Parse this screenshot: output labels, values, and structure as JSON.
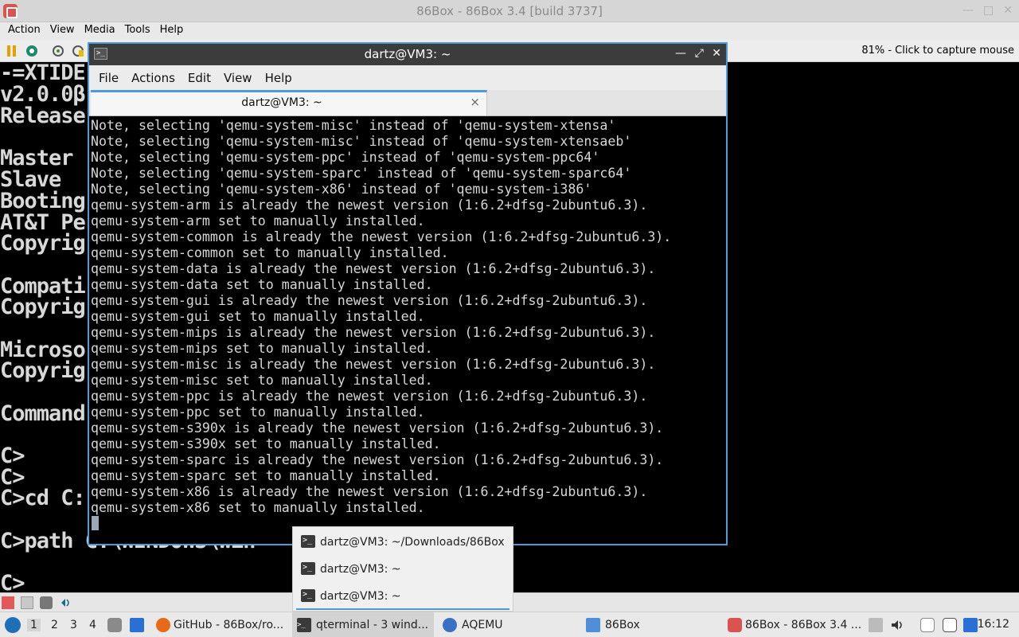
{
  "box": {
    "title": "86Box - 86Box 3.4 [build 3737]",
    "menu": [
      "Action",
      "View",
      "Media",
      "Tools",
      "Help"
    ],
    "status": "81% - Click to capture mouse"
  },
  "dos": {
    "lines": [
      "-=XTIDE",
      "v2.0.0β",
      "Release",
      "",
      "Master",
      "Slave",
      "Booting",
      "AT&T Pe",
      "Copyrig",
      "",
      "Compati",
      "Copyrig",
      "",
      "Microso",
      "Copyrig",
      "",
      "Command",
      "",
      "",
      "C>",
      "C>",
      "C>cd C:",
      "",
      "C>path C:\\WINDOWS\\win",
      "",
      "C>"
    ]
  },
  "qterminal": {
    "title": "dartz@VM3: ~",
    "menu": [
      "File",
      "Actions",
      "Edit",
      "View",
      "Help"
    ],
    "tab_label": "dartz@VM3: ~",
    "tab_close": "×",
    "lines": [
      "Note, selecting 'qemu-system-misc' instead of 'qemu-system-xtensa'",
      "Note, selecting 'qemu-system-misc' instead of 'qemu-system-xtensaeb'",
      "Note, selecting 'qemu-system-ppc' instead of 'qemu-system-ppc64'",
      "Note, selecting 'qemu-system-sparc' instead of 'qemu-system-sparc64'",
      "Note, selecting 'qemu-system-x86' instead of 'qemu-system-i386'",
      "qemu-system-arm is already the newest version (1:6.2+dfsg-2ubuntu6.3).",
      "qemu-system-arm set to manually installed.",
      "qemu-system-common is already the newest version (1:6.2+dfsg-2ubuntu6.3).",
      "qemu-system-common set to manually installed.",
      "qemu-system-data is already the newest version (1:6.2+dfsg-2ubuntu6.3).",
      "qemu-system-data set to manually installed.",
      "qemu-system-gui is already the newest version (1:6.2+dfsg-2ubuntu6.3).",
      "qemu-system-gui set to manually installed.",
      "qemu-system-mips is already the newest version (1:6.2+dfsg-2ubuntu6.3).",
      "qemu-system-mips set to manually installed.",
      "qemu-system-misc is already the newest version (1:6.2+dfsg-2ubuntu6.3).",
      "qemu-system-misc set to manually installed.",
      "qemu-system-ppc is already the newest version (1:6.2+dfsg-2ubuntu6.3).",
      "qemu-system-ppc set to manually installed.",
      "qemu-system-s390x is already the newest version (1:6.2+dfsg-2ubuntu6.3).",
      "qemu-system-s390x set to manually installed.",
      "qemu-system-sparc is already the newest version (1:6.2+dfsg-2ubuntu6.3).",
      "qemu-system-sparc set to manually installed.",
      "qemu-system-x86 is already the newest version (1:6.2+dfsg-2ubuntu6.3).",
      "qemu-system-x86 set to manually installed."
    ]
  },
  "popup": {
    "items": [
      "dartz@VM3: ~/Downloads/86Box",
      "dartz@VM3: ~",
      "dartz@VM3: ~"
    ]
  },
  "taskbar": {
    "workspaces": [
      "1",
      "2",
      "3",
      "4"
    ],
    "tasks": [
      "GitHub - 86Box/ro...",
      "qterminal - 3 wind...",
      "AQEMU",
      "86Box",
      "86Box - 86Box 3.4 ..."
    ],
    "clock": "16:12"
  },
  "colors": {
    "accent": "#4f9bd9",
    "titlebar": "#3c3c3c"
  }
}
